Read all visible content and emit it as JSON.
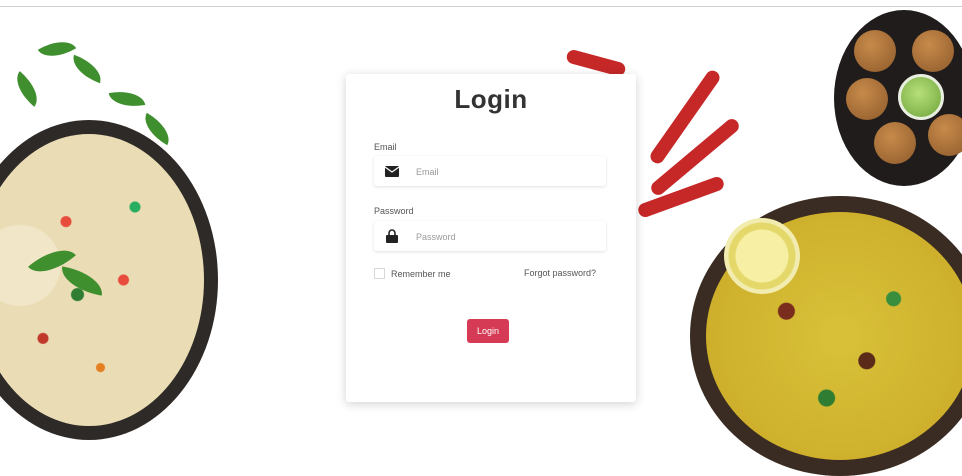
{
  "login": {
    "title": "Login",
    "email_label": "Email",
    "email_placeholder": "Email",
    "password_label": "Password",
    "password_placeholder": "Password",
    "remember_label": "Remember me",
    "forgot_link": "Forgot password?",
    "submit_label": "Login"
  },
  "colors": {
    "accent": "#d63b55",
    "card_background": "#ffffff",
    "title_text": "#333333"
  },
  "icons": {
    "email": "envelope-icon",
    "password": "lock-icon"
  }
}
